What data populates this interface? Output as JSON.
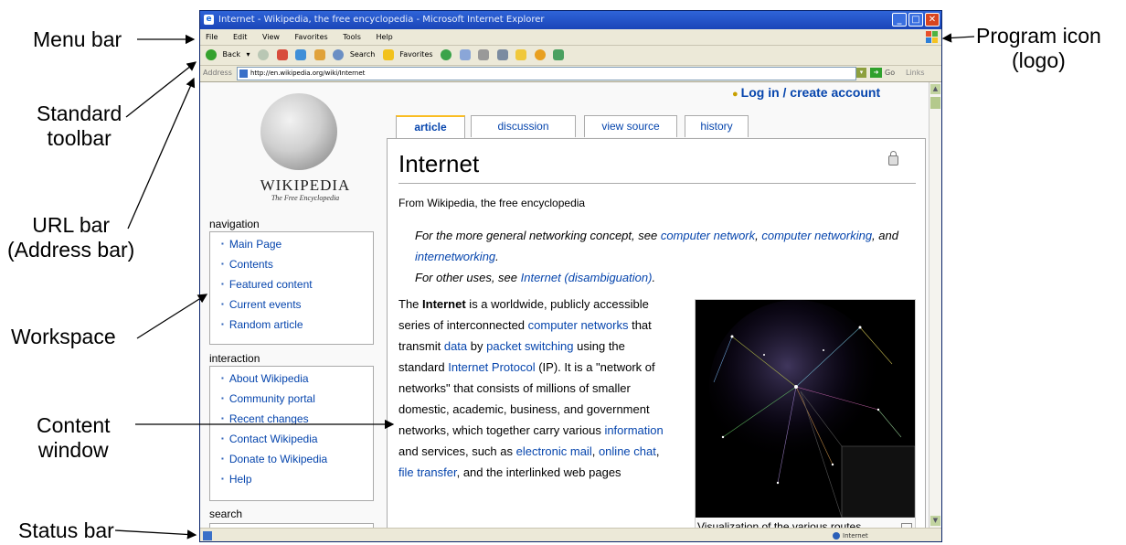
{
  "callouts": {
    "menu_bar": "Menu bar",
    "program_icon": "Program icon",
    "program_icon_sub": "(logo)",
    "standard_toolbar": "Standard",
    "standard_toolbar_sub": "toolbar",
    "url_bar": "URL bar",
    "url_bar_sub": "(Address bar)",
    "workspace": "Workspace",
    "content_window": "Content",
    "content_window_sub": "window",
    "status_bar": "Status bar"
  },
  "browser": {
    "title": "Internet - Wikipedia, the free encyclopedia - Microsoft Internet Explorer",
    "menu": [
      "File",
      "Edit",
      "View",
      "Favorites",
      "Tools",
      "Help"
    ],
    "toolbar": {
      "back": "Back",
      "search": "Search",
      "favorites": "Favorites"
    },
    "address": {
      "label": "Address",
      "url": "http://en.wikipedia.org/wiki/Internet",
      "go": "Go",
      "links": "Links"
    },
    "status": {
      "zone": "Internet"
    }
  },
  "page": {
    "login": "Log in / create account",
    "logo": {
      "wordmark": "WIKIPEDIA",
      "tagline": "The Free Encyclopedia"
    },
    "tabs": [
      "article",
      "discussion",
      "view source",
      "history"
    ],
    "navigation": {
      "heading": "navigation",
      "items": [
        "Main Page",
        "Contents",
        "Featured content",
        "Current events",
        "Random article"
      ]
    },
    "interaction": {
      "heading": "interaction",
      "items": [
        "About Wikipedia",
        "Community portal",
        "Recent changes",
        "Contact Wikipedia",
        "Donate to Wikipedia",
        "Help"
      ]
    },
    "search_heading": "search",
    "article": {
      "title": "Internet",
      "from": "From Wikipedia, the free encyclopedia",
      "dab1_pre": "For the more general networking concept, see ",
      "dab1_link1": "computer network",
      "dab1_sep": ", ",
      "dab1_link2": "computer networking",
      "dab1_and": ", and ",
      "dab1_link3": "internetworking",
      "dab1_end": ".",
      "dab2_pre": "For other uses, see ",
      "dab2_link": "Internet (disambiguation)",
      "dab2_end": ".",
      "p_the": "The ",
      "p_bold": "Internet",
      "p1": " is a worldwide, publicly accessible series of interconnected ",
      "l_networks": "computer networks",
      "p2": " that transmit ",
      "l_data": "data",
      "p3": " by ",
      "l_packet": "packet switching",
      "p4": " using the standard ",
      "l_ip": "Internet Protocol",
      "p5": " (IP). It is a \"network of networks\" that consists of millions of smaller domestic, academic, business, and government networks, which together carry various ",
      "l_info": "information",
      "p6": " and services, such as ",
      "l_email": "electronic mail",
      "p7": ", ",
      "l_chat": "online chat",
      "p8": ", ",
      "l_file": "file transfer",
      "p9": ", and the interlinked web pages",
      "caption": "Visualization of the various routes"
    }
  }
}
